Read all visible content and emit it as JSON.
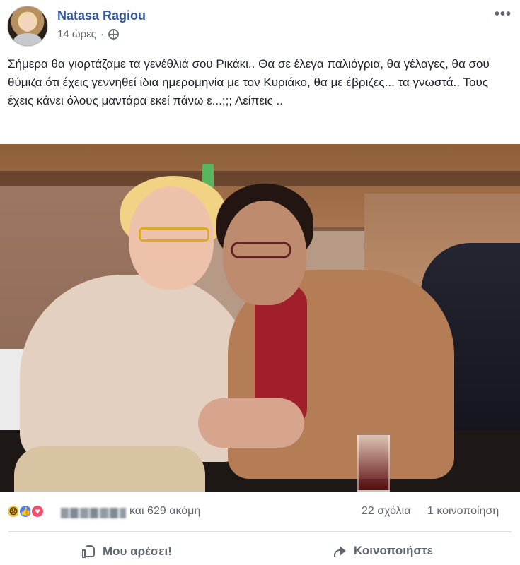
{
  "post": {
    "author": "Natasa Ragiou",
    "time": "14 ώρες",
    "separator": "·",
    "more": "•••",
    "text": "Σήμερα θα γιορτάζαμε τα γενέθλιά σου Ρικάκι.. Θα σε έλεγα παλιόγρια, θα γέλαγες, θα σου θύμιζα ότι έχεις γεννηθεί ίδια ημερομηνία με τον Κυριάκο, θα με έβριζες... τα γνωστά.. Τους έχεις κάνει όλους μαντάρα εκεί πάνω ε...;;; Λείπεις .."
  },
  "reactions": {
    "icons": [
      "sad-icon",
      "like-icon",
      "love-icon"
    ],
    "others": "και 629 ακόμη",
    "comments": "22 σχόλια",
    "shares": "1 κοινοποίηση"
  },
  "actions": {
    "like": "Μου αρέσει!",
    "share": "Κοινοποιήστε"
  },
  "colors": {
    "link": "#365899",
    "meta": "#616770",
    "action": "#606770",
    "like_reaction": "#4f7ff5",
    "love_reaction": "#f1506d",
    "sad_reaction": "#f6c34b"
  }
}
